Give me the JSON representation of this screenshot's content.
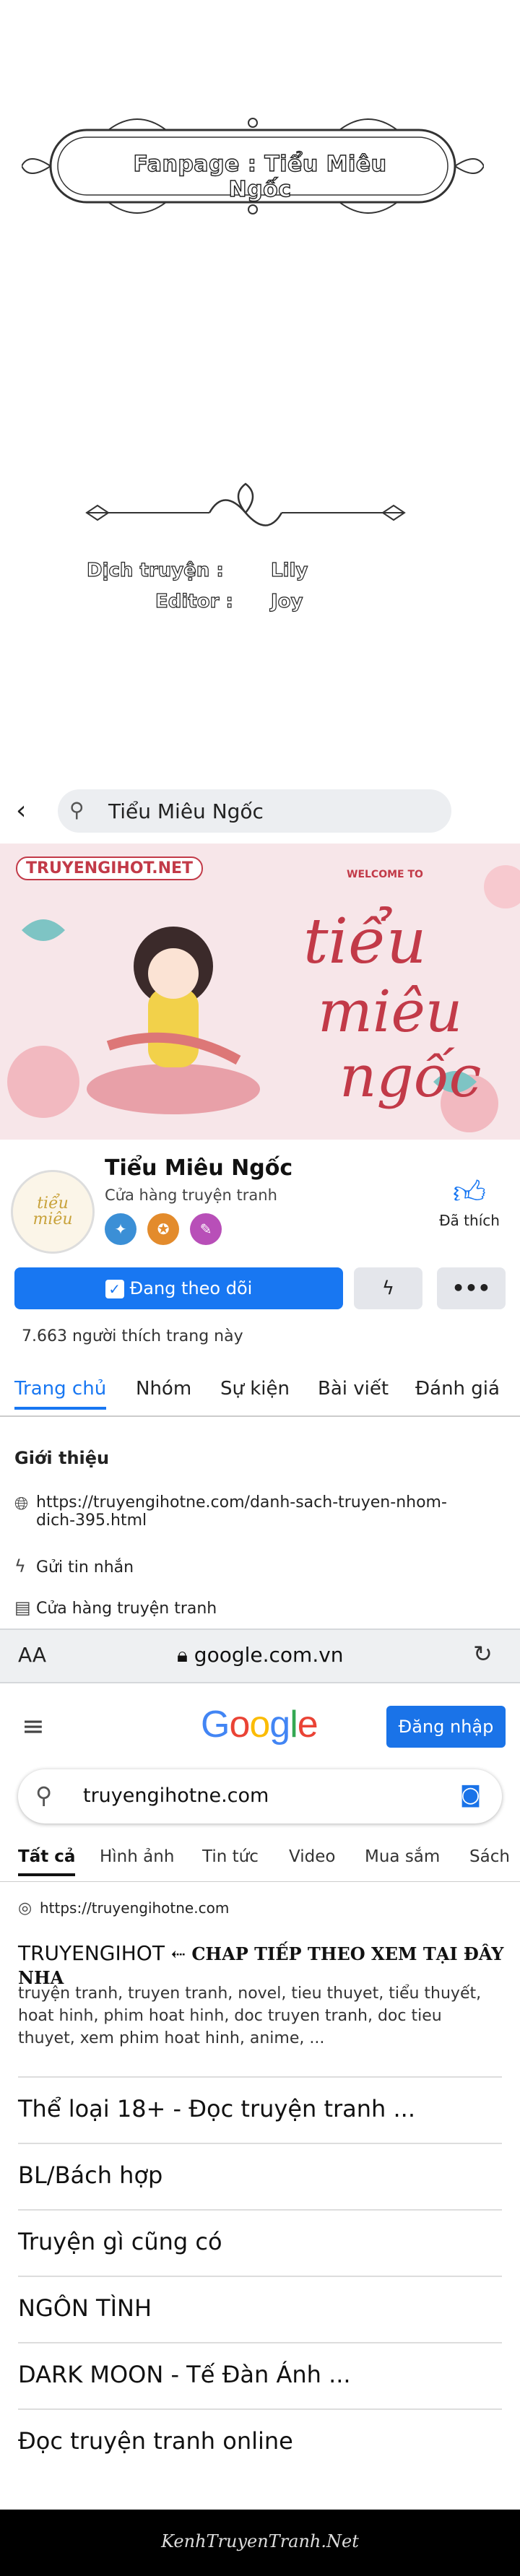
{
  "credits": {
    "fanpage": "Fanpage : Tiểu Miêu Ngốc",
    "translator_label": "Dịch truyện :",
    "translator_name": "Lily",
    "editor_label": "Editor :",
    "editor_name": "Joy"
  },
  "facebook": {
    "search_text": "Tiểu Miêu Ngốc",
    "cover_site": "TRUYENGIHOT.NET",
    "cover_welcome": "WELCOME TO",
    "page_name": "Tiểu Miêu Ngốc",
    "page_category": "Cửa hàng truyện tranh",
    "like_label": "Đã thích",
    "follow_label": "Đang theo dõi",
    "more_label": "•••",
    "likes_count": "7.663 người thích trang này",
    "tabs": [
      "Trang chủ",
      "Nhóm",
      "Sự kiện",
      "Bài viết",
      "Đánh giá"
    ],
    "intro_title": "Giới thiệu",
    "intro_link": "https://truyengihotne.com/danh-sach-truyen-nhom-dich-395.html",
    "intro_message": "Gửi tin nhắn",
    "intro_shop": "Cửa hàng truyện tranh"
  },
  "browser": {
    "aa_label": "AA",
    "url": "google.com.vn"
  },
  "google": {
    "logo": "Google",
    "signin_label": "Đăng nhập",
    "query": "truyengihotne.com",
    "tabs": [
      "Tất cả",
      "Hình ảnh",
      "Tin tức",
      "Video",
      "Mua sắm",
      "Sách"
    ],
    "result_url": "https://truyengihotne.com",
    "result_title_site": "TRUYENGIHOT",
    "result_title_cta": "⇠ CHAP TIẾP THEO XEM TẠI ĐÂY NHA",
    "result_snippet": "truyện tranh, truyen tranh, novel, tieu thuyet, tiểu thuyết, hoat hinh, phim hoat hinh, doc truyen tranh, doc tieu thuyet, xem phim hoat hinh, anime, ...",
    "links": [
      "Thể loại 18+ - Đọc truyện tranh ...",
      "BL/Bách hợp",
      "Truyện gì cũng có",
      "NGÔN TÌNH",
      "DARK MOON - Tế Đàn Ánh ...",
      "Đọc truyện tranh online"
    ]
  },
  "footer": {
    "watermark": "KenhTruyenTranh.Net"
  },
  "colors": {
    "fb_blue": "#1877f2",
    "google_blue": "#1a73e8"
  }
}
